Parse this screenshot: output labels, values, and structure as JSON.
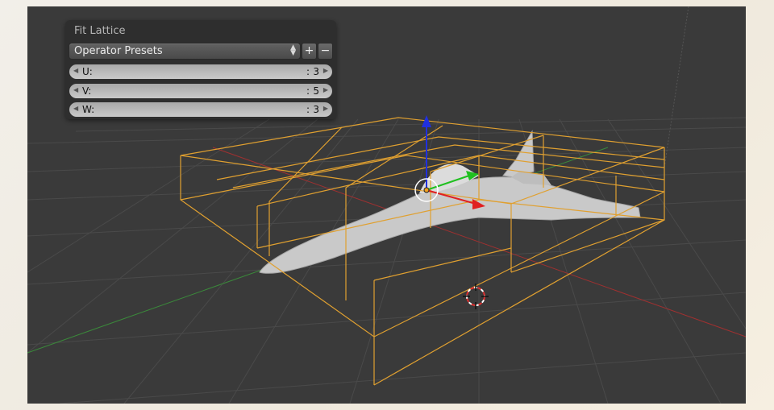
{
  "panel": {
    "title": "Fit Lattice",
    "preset_label": "Operator Presets",
    "add_symbol": "+",
    "remove_symbol": "−"
  },
  "fields": [
    {
      "name": "U:",
      "colon": ":",
      "value": "3"
    },
    {
      "name": "V:",
      "colon": ":",
      "value": "5"
    },
    {
      "name": "W:",
      "colon": ":",
      "value": "3"
    }
  ],
  "colors": {
    "viewport_bg": "#3a3a3a",
    "lattice": "#e0a030",
    "x_axis": "#a03030",
    "y_axis": "#3a8a3a",
    "gizmo_x": "#e02020",
    "gizmo_y": "#20c020",
    "gizmo_z": "#2030e0"
  }
}
